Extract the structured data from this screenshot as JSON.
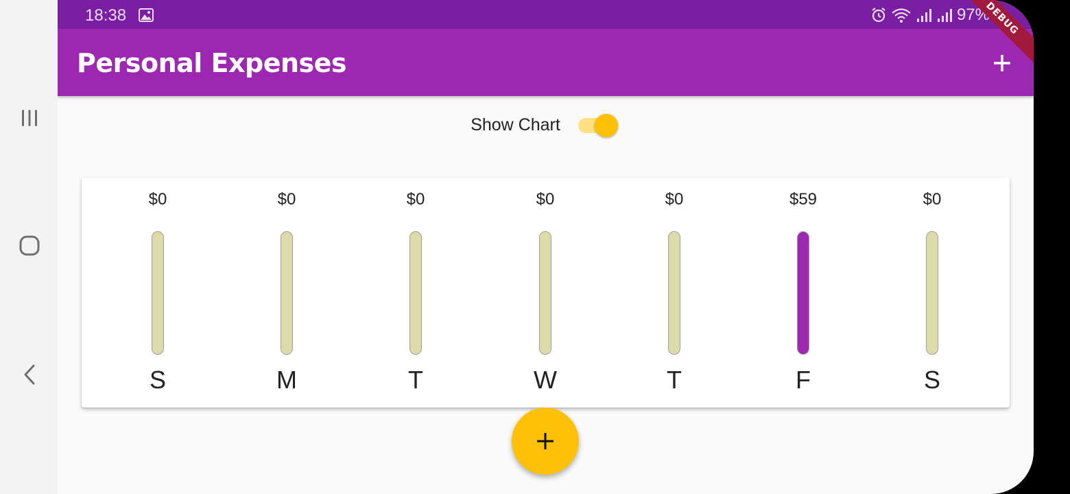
{
  "status_bar": {
    "time": "18:38",
    "battery": "97%",
    "icons": [
      "image-icon",
      "alarm-icon",
      "wifi-icon",
      "signal-icon",
      "signal-icon",
      "battery-icon"
    ]
  },
  "app_bar": {
    "title": "Personal Expenses",
    "add_icon": "plus-icon"
  },
  "debug_banner": "DEBUG",
  "toggle": {
    "label": "Show Chart",
    "checked": true
  },
  "chart_data": {
    "type": "bar",
    "categories": [
      "S",
      "M",
      "T",
      "W",
      "T",
      "F",
      "S"
    ],
    "amount_labels": [
      "$0",
      "$0",
      "$0",
      "$0",
      "$0",
      "$59",
      "$0"
    ],
    "values": [
      0,
      0,
      0,
      0,
      0,
      59,
      0
    ],
    "fill_fractions": [
      0,
      0,
      0,
      0,
      0,
      1,
      0
    ]
  },
  "fab": {
    "icon": "plus-icon"
  },
  "navigation": {
    "icons": [
      "recents-icon",
      "home-icon",
      "back-icon"
    ]
  },
  "colors": {
    "primary": "#9c27b0",
    "primary_dark": "#7b1fa2",
    "accent": "#ffc107",
    "bar_track": "#dcdcab"
  }
}
